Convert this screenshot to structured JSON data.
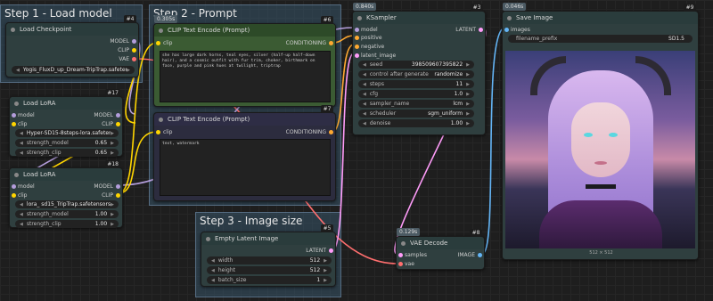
{
  "groups": {
    "load_model": "Step 1 - Load model",
    "prompt": "Step 2 - Prompt",
    "image_size": "Step 3 - Image size"
  },
  "nodes": {
    "load_checkpoint": {
      "id": "#4",
      "title": "Load Checkpoint",
      "outputs": [
        "MODEL",
        "CLIP",
        "VAE"
      ],
      "ckpt": "Yogis_FluxD_up_Dream-TripTrap.safeten..."
    },
    "lora1": {
      "id": "#17",
      "title": "Load LoRA",
      "in_model": "model",
      "in_clip": "clip",
      "out_model": "MODEL",
      "out_clip": "CLIP",
      "lora_name": "Hyper-SD15-8steps-lora.safeten...",
      "strength_model_label": "strength_model",
      "strength_model": "0.65",
      "strength_clip_label": "strength_clip",
      "strength_clip": "0.65"
    },
    "lora2": {
      "id": "#18",
      "title": "Load LoRA",
      "in_model": "model",
      "in_clip": "clip",
      "out_model": "MODEL",
      "out_clip": "CLIP",
      "lora_name": "lora_ sd15_TripTrap.safetensors",
      "strength_model_label": "strength_model",
      "strength_model": "1.00",
      "strength_clip_label": "strength_clip",
      "strength_clip": "1.00"
    },
    "clip_pos": {
      "id": "#6",
      "time": "0.305s",
      "title": "CLIP Text Encode (Prompt)",
      "in_clip": "clip",
      "out": "CONDITIONING",
      "text": "she has large dark horns, teal eyes, silver (half-up half-down hair), and a cosmic outfit with fur trim, choker, birthmark on face, purple and pink hues at twilight, triptrap"
    },
    "clip_neg": {
      "id": "#7",
      "title": "CLIP Text Encode (Prompt)",
      "in_clip": "clip",
      "out": "CONDITIONING",
      "text": "text, watermark"
    },
    "empty_latent": {
      "id": "#5",
      "title": "Empty Latent Image",
      "out": "LATENT",
      "width_label": "width",
      "width": "512",
      "height_label": "height",
      "height": "512",
      "batch_label": "batch_size",
      "batch": "1"
    },
    "ksampler": {
      "id": "#3",
      "time": "0.840s",
      "title": "KSampler",
      "inputs": [
        "model",
        "positive",
        "negative",
        "latent_image"
      ],
      "out": "LATENT",
      "widgets": [
        {
          "label": "seed",
          "value": "398509607395822"
        },
        {
          "label": "control after generate",
          "value": "randomize"
        },
        {
          "label": "steps",
          "value": "11"
        },
        {
          "label": "cfg",
          "value": "1.0"
        },
        {
          "label": "sampler_name",
          "value": "lcm"
        },
        {
          "label": "scheduler",
          "value": "sgm_uniform"
        },
        {
          "label": "denoise",
          "value": "1.00"
        }
      ]
    },
    "vae_decode": {
      "id": "#8",
      "time": "0.129s",
      "title": "VAE Decode",
      "in_samples": "samples",
      "in_vae": "vae",
      "out": "IMAGE"
    },
    "save_image": {
      "id": "#9",
      "time": "0.046s",
      "title": "Save Image",
      "in_images": "images",
      "prefix_label": "filename_prefix",
      "prefix": "SD1.5",
      "size": "512 × 512"
    }
  },
  "colors": {
    "model": "#b39ddb",
    "clip": "#ffd500",
    "vae": "#ff6e6e",
    "conditioning": "#ffa931",
    "latent": "#ff9cf9",
    "image": "#64b5f6"
  }
}
